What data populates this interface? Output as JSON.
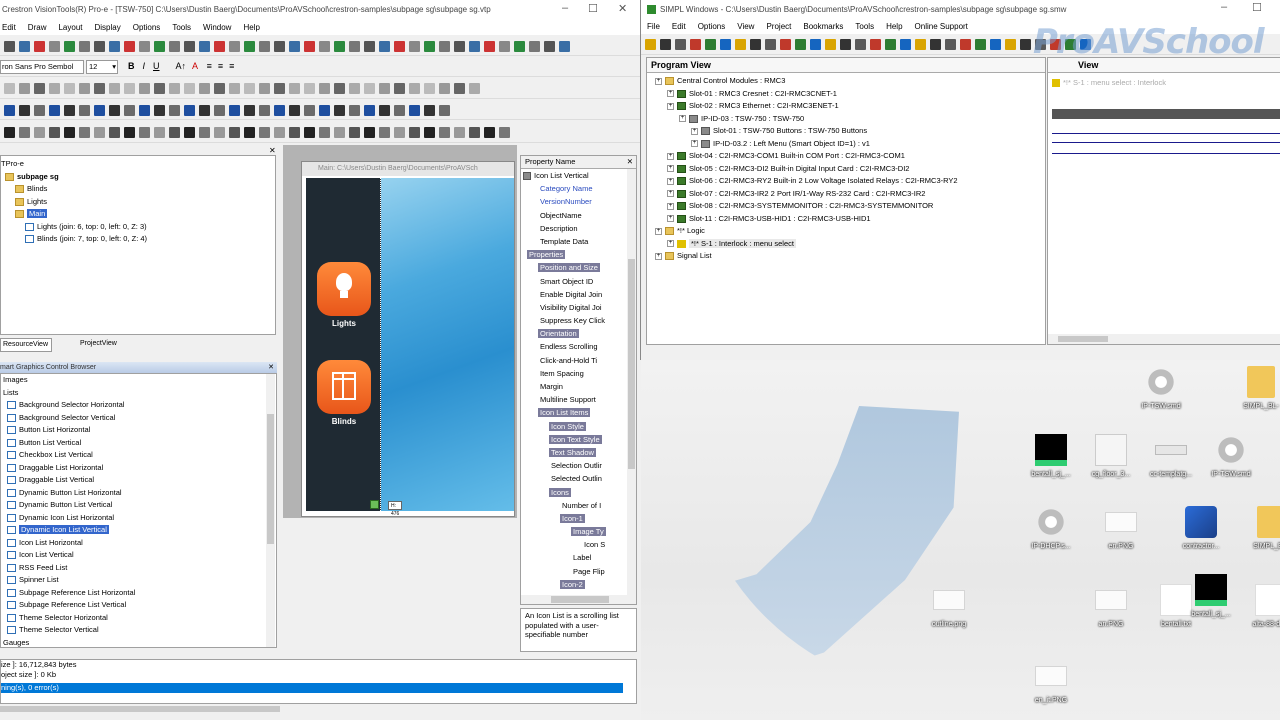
{
  "left_window": {
    "title": "Crestron VisionTools(R) Pro-e - [TSW-750] C:\\Users\\Dustin Baerg\\Documents\\ProAVSchool\\crestron-samples\\subpage sg\\subpage sg.vtp",
    "menu": [
      "Edit",
      "Draw",
      "Layout",
      "Display",
      "Options",
      "Tools",
      "Window",
      "Help"
    ],
    "font_name": "ron Sans Pro Sembol",
    "font_size": "12",
    "project_tree": {
      "root": "TPro-e",
      "items": [
        {
          "label": "subpage sg",
          "bold": true,
          "indent": 0
        },
        {
          "label": "Blinds",
          "indent": 1
        },
        {
          "label": "Lights",
          "indent": 1
        },
        {
          "label": "Main",
          "indent": 1,
          "selected": true
        },
        {
          "label": "Lights (join: 6, top: 0, left: 0, Z: 3)",
          "indent": 2
        },
        {
          "label": "Blinds (join: 7, top: 0, left: 0, Z: 4)",
          "indent": 2
        }
      ],
      "tabs": [
        "ResourceView",
        "ProjectView"
      ]
    },
    "control_browser": {
      "title": "mart Graphics Control Browser",
      "top_items": [
        "Images",
        "Lists"
      ],
      "lists": [
        "Background Selector Horizontal",
        "Background Selector Vertical",
        "Button List Horizontal",
        "Button List Vertical",
        "Checkbox List Vertical",
        "Draggable List Horizontal",
        "Draggable List Vertical",
        "Dynamic Button List Horizontal",
        "Dynamic Button List Vertical",
        "Dynamic Icon List Horizontal",
        "Dynamic Icon List Vertical",
        "Icon List Horizontal",
        "Icon List Vertical",
        "RSS Feed List",
        "Spinner List",
        "Subpage Reference List Horizontal",
        "Subpage Reference List Vertical",
        "Theme Selector Horizontal",
        "Theme Selector Vertical"
      ],
      "selected_index": 10,
      "bottom_item": "Gauges"
    },
    "canvas": {
      "title": "Main: C:\\Users\\Dustin Baerg\\Documents\\ProAVSch",
      "buttons": [
        {
          "label": "Lights"
        },
        {
          "label": "Blinds"
        }
      ],
      "height_readout": "H: 476"
    },
    "properties": {
      "header": "Property Name",
      "root": "Icon List Vertical",
      "rows": [
        {
          "label": "Category Name",
          "style": "blue",
          "indent": 1
        },
        {
          "label": "VersionNumber",
          "style": "blue",
          "indent": 1
        },
        {
          "label": "ObjectName",
          "indent": 1
        },
        {
          "label": "Description",
          "indent": 1
        },
        {
          "label": "Template Data",
          "indent": 1
        },
        {
          "label": "Properties",
          "style": "hl",
          "indent": 0
        },
        {
          "label": "Position and Size",
          "style": "hl",
          "indent": 1
        },
        {
          "label": "Smart Object ID",
          "indent": 1
        },
        {
          "label": "Enable Digital Join",
          "indent": 1
        },
        {
          "label": "Visibility Digital Joi",
          "indent": 1
        },
        {
          "label": "Suppress Key Click",
          "indent": 1
        },
        {
          "label": "Orientation",
          "style": "hl",
          "indent": 1
        },
        {
          "label": "Endless Scrolling",
          "indent": 1
        },
        {
          "label": "Click-and-Hold Ti",
          "indent": 1
        },
        {
          "label": "Item Spacing",
          "indent": 1
        },
        {
          "label": "Margin",
          "indent": 1
        },
        {
          "label": "Multiline Support",
          "indent": 1
        },
        {
          "label": "Icon List Items",
          "style": "hl",
          "indent": 1
        },
        {
          "label": "Icon Style",
          "style": "hl",
          "indent": 2
        },
        {
          "label": "Icon Text Style",
          "style": "hl",
          "indent": 2
        },
        {
          "label": "Text Shadow",
          "style": "hl",
          "indent": 2
        },
        {
          "label": "Selection Outlir",
          "indent": 2
        },
        {
          "label": "Selected Outlin",
          "indent": 2
        },
        {
          "label": "Icons",
          "style": "hl",
          "indent": 2
        },
        {
          "label": "Number of I",
          "indent": 3
        },
        {
          "label": "Icon-1",
          "style": "hl",
          "indent": 3
        },
        {
          "label": "Image Ty",
          "style": "hl",
          "indent": 4
        },
        {
          "label": "Icon S",
          "indent": 5
        },
        {
          "label": "Label",
          "indent": 4
        },
        {
          "label": "Page Flip",
          "indent": 4
        },
        {
          "label": "Icon-2",
          "style": "hl",
          "indent": 3
        }
      ],
      "description": "An Icon List is a scrolling list populated with a user-specifiable number"
    },
    "status": {
      "line1": "ize ]: 16,712,843 bytes",
      "line2": "oject size ]: 0 Kb",
      "line3": "ning(s), 0 error(s)"
    }
  },
  "right_window": {
    "title": "SIMPL Windows - C:\\Users\\Dustin Baerg\\Documents\\ProAVSchool\\crestron-samples\\subpage sg\\subpage sg.smw",
    "menu": [
      "File",
      "Edit",
      "Options",
      "View",
      "Project",
      "Bookmarks",
      "Tools",
      "Help",
      "Online Support"
    ],
    "program_view": {
      "header": "Program View",
      "items": [
        {
          "label": "Central Control Modules : RMC3",
          "indent": 0,
          "icon": "folder"
        },
        {
          "label": "Slot-01 : RMC3 Cresnet : C2I-RMC3CNET-1",
          "indent": 1,
          "icon": "green"
        },
        {
          "label": "Slot-02 : RMC3 Ethernet : C2I-RMC3ENET-1",
          "indent": 1,
          "icon": "green"
        },
        {
          "label": "IP-ID-03 : TSW-750 : TSW-750",
          "indent": 2,
          "icon": "device"
        },
        {
          "label": "Slot-01 : TSW-750 Buttons : TSW-750 Buttons",
          "indent": 3,
          "icon": "device"
        },
        {
          "label": "IP-ID-03.2 : Left Menu (Smart Object ID=1) : v1",
          "indent": 3,
          "icon": "device"
        },
        {
          "label": "Slot-04 : C2I-RMC3-COM1 Built-in COM Port : C2I-RMC3-COM1",
          "indent": 1,
          "icon": "green"
        },
        {
          "label": "Slot-05 : C2I-RMC3-DI2 Built-in Digital Input Card : C2I-RMC3-DI2",
          "indent": 1,
          "icon": "green"
        },
        {
          "label": "Slot-06 : C2I-RMC3-RY2 Built-in 2 Low Voltage Isolated Relays : C2I-RMC3-RY2",
          "indent": 1,
          "icon": "green"
        },
        {
          "label": "Slot-07 : C2I-RMC3-IR2 2 Port IR/1-Way RS-232 Card : C2I-RMC3-IR2",
          "indent": 1,
          "icon": "green"
        },
        {
          "label": "Slot-08 : C2I-RMC3-SYSTEMMONITOR : C2I-RMC3-SYSTEMMONITOR",
          "indent": 1,
          "icon": "green"
        },
        {
          "label": "Slot-11 : C2I-RMC3-USB-HID1 : C2I-RMC3-USB-HID1",
          "indent": 1,
          "icon": "green"
        },
        {
          "label": "*!* Logic",
          "indent": 0,
          "icon": "folder"
        },
        {
          "label": "*!* S-1 : Interlock : menu select",
          "indent": 1,
          "icon": "logic",
          "highlight": true
        },
        {
          "label": "Signal List",
          "indent": 0,
          "icon": "folder"
        }
      ]
    },
    "detail_view": {
      "header": "View",
      "item": "*!* S-1 : menu select : Interlock"
    },
    "watermark": "ProAVSchool"
  },
  "desktop": {
    "icons": [
      {
        "label": "IP-TSW.smd",
        "kind": "gear"
      },
      {
        "label": "SIMPL_BL-",
        "kind": "folder"
      },
      {
        "label": "bentall_sj_...",
        "kind": "black"
      },
      {
        "label": "cg_floor_3...",
        "kind": "template"
      },
      {
        "label": "cc-templatg...",
        "kind": "flat"
      },
      {
        "label": "IP-TSW.smd",
        "kind": "gear"
      },
      {
        "label": "IP-DHCP.s...",
        "kind": "gear"
      },
      {
        "label": "en.PNG",
        "kind": "image"
      },
      {
        "label": "contractor...",
        "kind": "app"
      },
      {
        "label": "SIMPL_BL-",
        "kind": "folder"
      },
      {
        "label": "outline.png",
        "kind": "image"
      },
      {
        "label": "an.PNG",
        "kind": "image"
      },
      {
        "label": "bentall.txt",
        "kind": "blank"
      },
      {
        "label": "bentall_sj_...",
        "kind": "black"
      },
      {
        "label": "alta-88-dc...",
        "kind": "blank"
      },
      {
        "label": "en_it.PNG",
        "kind": "image"
      }
    ]
  },
  "colors": {
    "accent_orange": "#f26a1b",
    "selection_blue": "#0078d7",
    "tree_select": "#3366cc"
  }
}
